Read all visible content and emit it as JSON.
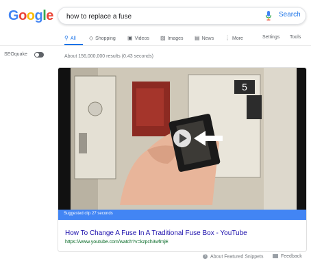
{
  "logo": {
    "letters": [
      "G",
      "o",
      "o",
      "g",
      "l",
      "e"
    ]
  },
  "search": {
    "query": "how to replace a fuse",
    "button_label": "Search"
  },
  "tabs": [
    {
      "label": "All",
      "icon": "search-icon",
      "active": true
    },
    {
      "label": "Shopping",
      "icon": "tag-icon"
    },
    {
      "label": "Videos",
      "icon": "video-icon"
    },
    {
      "label": "Images",
      "icon": "image-icon"
    },
    {
      "label": "News",
      "icon": "news-icon"
    },
    {
      "label": "More",
      "icon": "more-icon"
    },
    {
      "label": "Settings"
    },
    {
      "label": "Tools"
    }
  ],
  "seoquake": {
    "label": "SEOquake"
  },
  "results_stats": "About 156,000,000 results (0.43 seconds)",
  "featured": {
    "video_step_number": "5",
    "clip_label": "Suggested clip 27 seconds",
    "title": "How To Change A Fuse In A Traditional Fuse Box - YouTube",
    "url": "https://www.youtube.com/watch?v=kzpch3wfmjE"
  },
  "footer": {
    "about_label": "About Featured Snippets",
    "feedback_label": "Feedback"
  },
  "colors": {
    "accent": "#1a73e8",
    "clip_bar": "#4285f4",
    "link": "#1a0dab",
    "url": "#006621"
  }
}
